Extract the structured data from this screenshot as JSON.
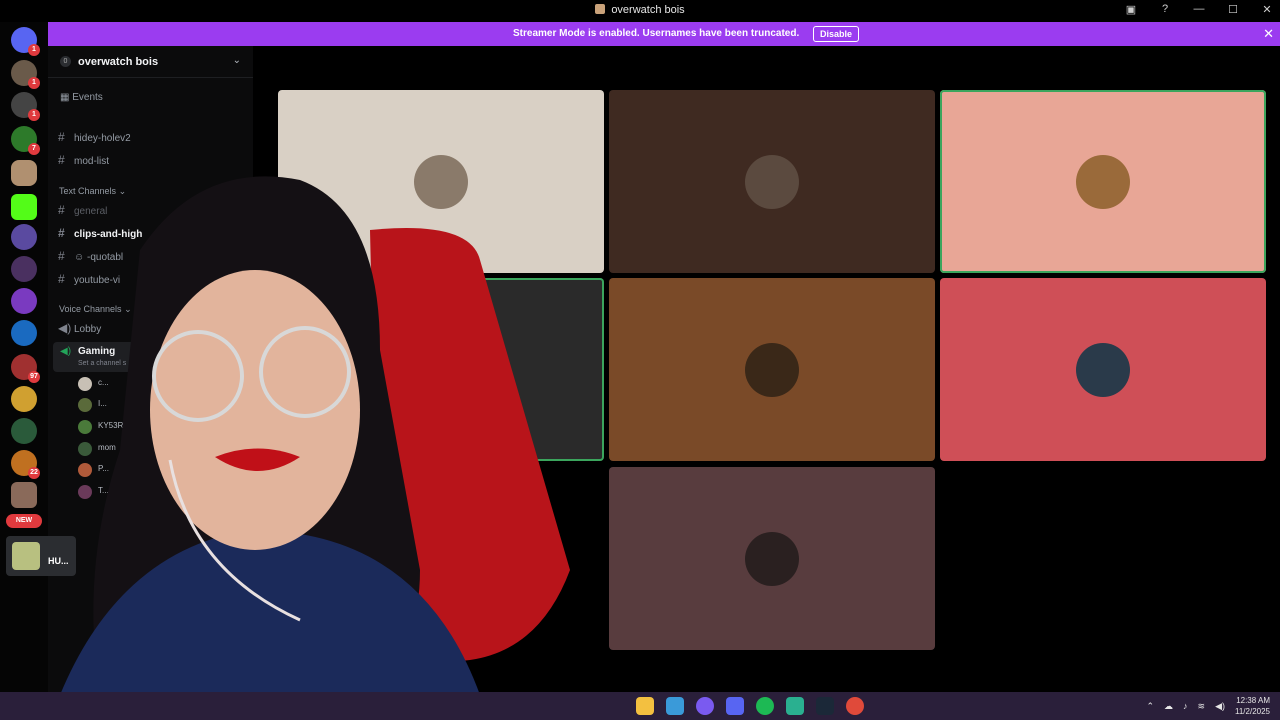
{
  "window": {
    "title": "overwatch bois",
    "controls": [
      "—",
      "☐",
      "✕"
    ]
  },
  "banner": {
    "message": "Streamer Mode is enabled. Usernames have been truncated.",
    "button": "Disable",
    "close_icon": "close-icon"
  },
  "guild_badges": [
    "1",
    "1",
    "1",
    "7",
    "97",
    "22"
  ],
  "guild_new": "NEW",
  "server": {
    "name": "overwatch bois",
    "icon_label": "0"
  },
  "events_label": "Events",
  "channels_top": [
    "hidey-holev2",
    "mod-list"
  ],
  "categories": {
    "text": "Text Channels",
    "voice": "Voice Channels"
  },
  "text_channels": [
    "general",
    "clips-and-high",
    "-quotabl",
    "youtube-vi"
  ],
  "voice_channels": {
    "lobby": "Lobby",
    "gaming": "Gaming",
    "gaming_sub": "Set a channel s"
  },
  "voice_members": [
    "c...",
    "I...",
    "KY53R",
    "mom",
    "P...",
    "T..."
  ],
  "user_card": {
    "name": "HU..."
  },
  "call_tiles": [
    {
      "bg": "#d9d0c5",
      "avatar": "#8a7a6a",
      "speaking": false
    },
    {
      "bg": "#3f2a21",
      "avatar": "#5b4a3f",
      "speaking": false
    },
    {
      "bg": "#e8a696",
      "avatar": "#9a6a3a",
      "speaking": true
    },
    {
      "bg": "#2a2a2a",
      "avatar": "#444444",
      "speaking": true
    },
    {
      "bg": "#7a4a28",
      "avatar": "#3a2818",
      "speaking": false
    },
    {
      "bg": "#cf4f57",
      "avatar": "#2a3a4a",
      "speaking": false
    },
    {
      "bg": "#583c3e",
      "avatar": "#2a2020",
      "speaking": false
    }
  ],
  "taskbar": {
    "time": "12:38 AM",
    "date": "11/2/2025"
  },
  "colors": {
    "accent": "#9b3cf0",
    "speaking": "#3ba55d",
    "badge": "#e03a3e"
  }
}
